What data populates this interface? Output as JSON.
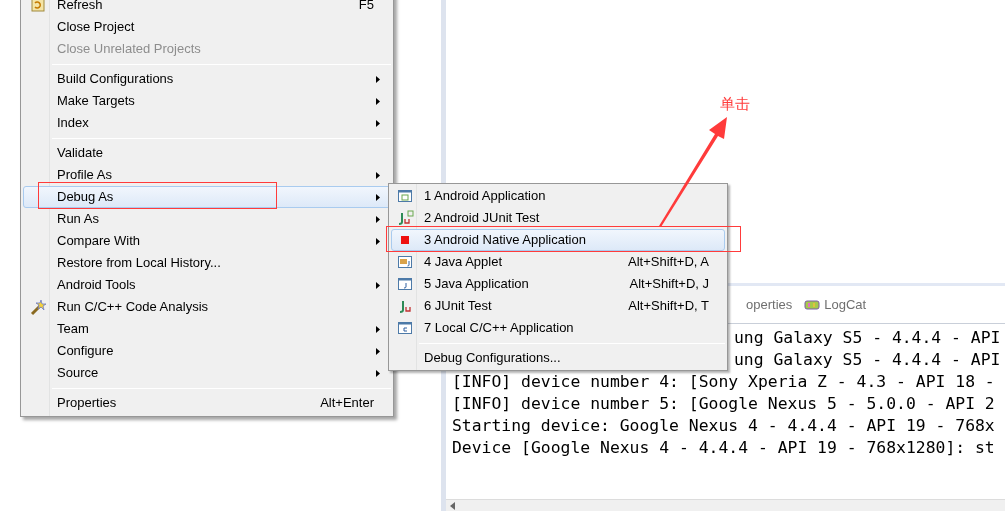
{
  "context_menu": {
    "items": [
      {
        "kind": "item",
        "label": "Refresh",
        "shortcut": "F5",
        "disabled": false,
        "submenu": false,
        "selected": false
      },
      {
        "kind": "item",
        "label": "Close Project",
        "disabled": false,
        "submenu": false,
        "selected": false
      },
      {
        "kind": "item",
        "label": "Close Unrelated Projects",
        "disabled": true,
        "submenu": false,
        "selected": false
      },
      {
        "kind": "separator"
      },
      {
        "kind": "item",
        "label": "Build Configurations",
        "disabled": false,
        "submenu": true,
        "selected": false
      },
      {
        "kind": "item",
        "label": "Make Targets",
        "disabled": false,
        "submenu": true,
        "selected": false
      },
      {
        "kind": "item",
        "label": "Index",
        "disabled": false,
        "submenu": true,
        "selected": false
      },
      {
        "kind": "separator"
      },
      {
        "kind": "item",
        "label": "Validate",
        "disabled": false,
        "submenu": false,
        "selected": false
      },
      {
        "kind": "item",
        "label": "Profile As",
        "disabled": false,
        "submenu": true,
        "selected": false
      },
      {
        "kind": "item",
        "label": "Debug As",
        "disabled": false,
        "submenu": true,
        "selected": true
      },
      {
        "kind": "item",
        "label": "Run As",
        "disabled": false,
        "submenu": true,
        "selected": false
      },
      {
        "kind": "item",
        "label": "Compare With",
        "disabled": false,
        "submenu": true,
        "selected": false
      },
      {
        "kind": "item",
        "label": "Restore from Local History...",
        "disabled": false,
        "submenu": false,
        "selected": false
      },
      {
        "kind": "item",
        "label": "Android Tools",
        "disabled": false,
        "submenu": true,
        "selected": false
      },
      {
        "kind": "item",
        "label": "Run C/C++ Code Analysis",
        "disabled": false,
        "submenu": false,
        "selected": false
      },
      {
        "kind": "item",
        "label": "Team",
        "disabled": false,
        "submenu": true,
        "selected": false
      },
      {
        "kind": "item",
        "label": "Configure",
        "disabled": false,
        "submenu": true,
        "selected": false
      },
      {
        "kind": "item",
        "label": "Source",
        "disabled": false,
        "submenu": true,
        "selected": false
      },
      {
        "kind": "separator"
      },
      {
        "kind": "item",
        "label": "Properties",
        "shortcut": "Alt+Enter",
        "disabled": false,
        "submenu": false,
        "selected": false
      }
    ]
  },
  "debug_as_submenu": {
    "items": [
      {
        "kind": "item",
        "label": "1 Android Application",
        "selected": false
      },
      {
        "kind": "item",
        "label": "2 Android JUnit Test",
        "selected": false
      },
      {
        "kind": "item",
        "label": "3 Android Native Application",
        "selected": true
      },
      {
        "kind": "item",
        "label": "4 Java Applet",
        "shortcut": "Alt+Shift+D, A",
        "selected": false
      },
      {
        "kind": "item",
        "label": "5 Java Application",
        "shortcut": "Alt+Shift+D, J",
        "selected": false
      },
      {
        "kind": "item",
        "label": "6 JUnit Test",
        "shortcut": "Alt+Shift+D, T",
        "selected": false
      },
      {
        "kind": "item",
        "label": "7 Local C/C++ Application",
        "selected": false
      },
      {
        "kind": "separator"
      },
      {
        "kind": "item",
        "label": "Debug Configurations...",
        "selected": false
      }
    ]
  },
  "console_panel": {
    "tabs": [
      {
        "label": "operties"
      },
      {
        "label": "LogCat"
      }
    ],
    "lines": [
      {
        "text": "ung Galaxy S5 - 4.4.4 - API",
        "partial": true
      },
      {
        "text": "ung Galaxy S5 - 4.4.4 - API",
        "partial": true
      },
      {
        "text": "[INFO] device number 4: [Sony Xperia Z - 4.3 - API 18 -",
        "partial": false
      },
      {
        "text": "[INFO] device number 5: [Google Nexus 5 - 5.0.0 - API 2",
        "partial": false
      },
      {
        "text": "Starting device: Google Nexus 4 - 4.4.4 - API 19 - 768x",
        "partial": false
      },
      {
        "text": "Device [Google Nexus 4 - 4.4.4 - API 19 - 768x1280]: st",
        "partial": false
      }
    ]
  },
  "annotation": {
    "text": "单击"
  }
}
